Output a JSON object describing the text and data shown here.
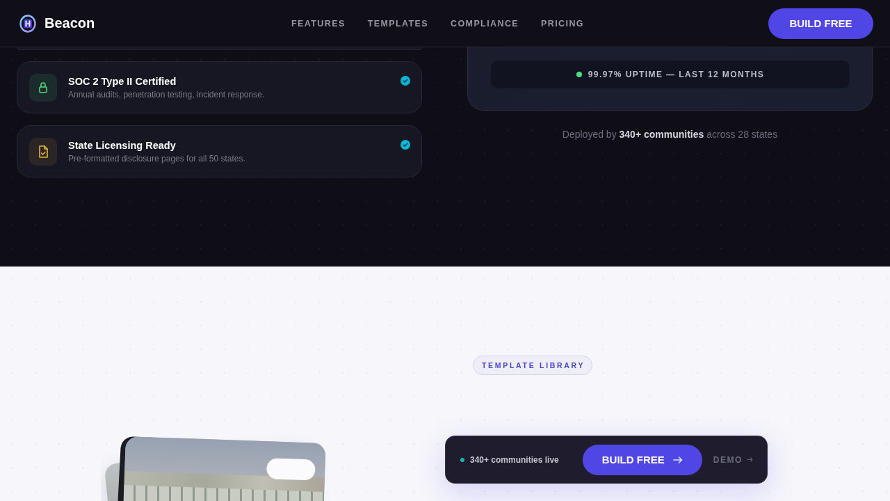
{
  "nav": {
    "brand": "Beacon",
    "links": [
      {
        "label": "FEATURES"
      },
      {
        "label": "TEMPLATES"
      },
      {
        "label": "COMPLIANCE"
      },
      {
        "label": "PRICING"
      }
    ],
    "cta": "BUILD FREE"
  },
  "features": [
    {
      "kind": "lock",
      "title": "SOC 2 Type II Certified",
      "description": "Annual audits, penetration testing, incident response.",
      "verified": true
    },
    {
      "kind": "document",
      "title": "State Licensing Ready",
      "description": "Pre-formatted disclosure pages for all 50 states.",
      "verified": true
    }
  ],
  "uptime": {
    "label": "99.97% UPTIME — LAST 12 MONTHS"
  },
  "deployment_note": "Deployed by **340+ communities** across 28 states",
  "template_library": {
    "eyebrow": "TEMPLATE LIBRARY"
  },
  "sticky_cta": {
    "status": "340+ communities live",
    "button": "BUILD FREE",
    "link": "DEMO"
  }
}
